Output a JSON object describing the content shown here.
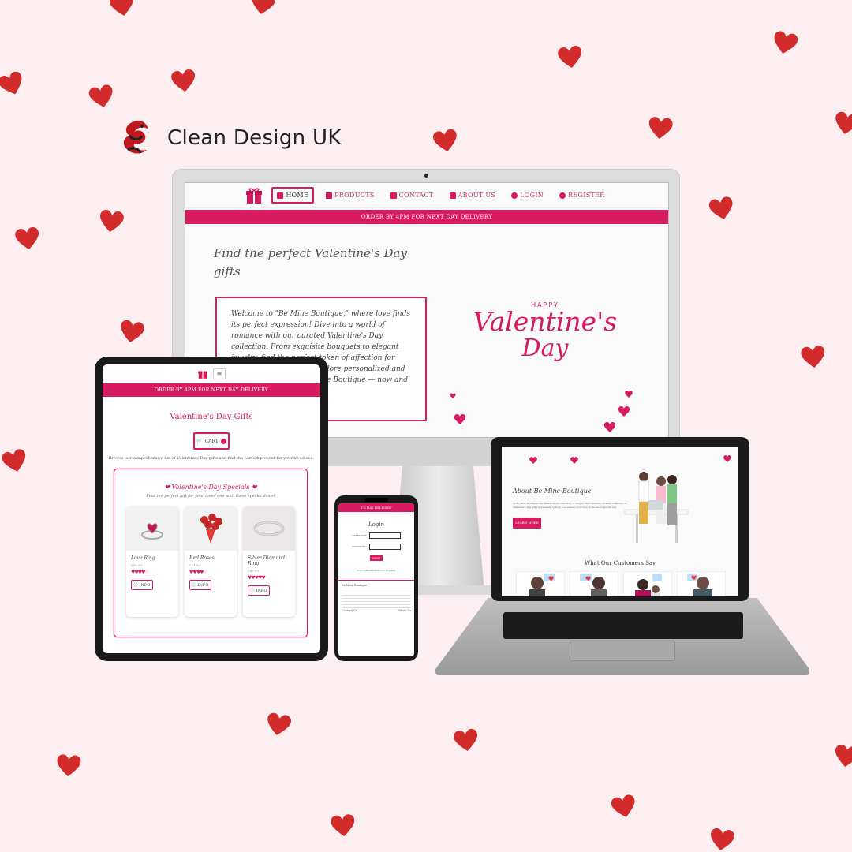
{
  "brand": {
    "name": "Clean Design UK"
  },
  "colors": {
    "accent": "#d81b60",
    "heart": "#d22b2b",
    "background": "#fdeef2"
  },
  "desktop": {
    "nav": [
      {
        "label": "HOME",
        "icon": "home-icon"
      },
      {
        "label": "PRODUCTS",
        "icon": "gift-icon"
      },
      {
        "label": "CONTACT",
        "icon": "envelope-icon"
      },
      {
        "label": "ABOUT US",
        "icon": "book-icon"
      },
      {
        "label": "LOGIN",
        "icon": "user-icon"
      },
      {
        "label": "REGISTER",
        "icon": "user-plus-icon"
      }
    ],
    "banner": "ORDER BY 4PM FOR NEXT DAY DELIVERY",
    "hero_title": "Find the perfect Valentine's Day gifts",
    "hero_text": "Welcome to \"Be Mine Boutique,\" where love finds its perfect expression! Dive into a world of romance with our curated Valentine's Day collection. From exquisite bouquets to elegant jewelry, find the perfect token of affection for your special someone. Explore personalized and delightful treats to Be Mine Boutique — now and let us be your moments.",
    "vday": {
      "happy": "HAPPY",
      "big": "Valentine's",
      "day": "Day"
    }
  },
  "tablet": {
    "banner": "ORDER BY 4PM FOR NEXT DAY DELIVERY",
    "title": "Valentine's Day Gifts",
    "cart_label": "CART",
    "cart_count": "0",
    "description": "Browse our comprehensive list of Valentine's Day gifts and find the perfect present for your loved one.",
    "specials_title": "Valentine's Day Specials",
    "specials_sub": "Find the perfect gift for your loved one with these special deals!",
    "products": [
      {
        "name": "Love Ring",
        "price": "£59.99",
        "hearts": "♥♥♥♥♡",
        "info": "INFO",
        "img": "ring-icon"
      },
      {
        "name": "Red Roses",
        "price": "£44.99",
        "hearts": "♥♥♥♥♡",
        "info": "INFO",
        "img": "roses-icon"
      },
      {
        "name": "Silver Diamond Ring",
        "price": "£49.99",
        "hearts": "♥♥♥♥♥",
        "info": "INFO",
        "img": "diamond-ring-icon"
      }
    ]
  },
  "phone": {
    "banner": "UK DAY DELIVERY",
    "login_title": "Login",
    "username_label": "USERNAME",
    "password_label": "PASSWORD",
    "login_button": "LOGIN",
    "register_text": "Don't have an account? Register",
    "footer_title": "Be Mine Boutique",
    "contact_title": "Contact Us",
    "follow_title": "Follow Us"
  },
  "laptop": {
    "about_title": "About Be Mine Boutique",
    "about_text": "At Be Mine Boutique, we believe every love story is unique. Our carefully curated collection of Valentine's Day gifts is designed to help you express your love in the most special way.",
    "learn_more": "LEARN MORE",
    "customers_title": "What Our Customers Say"
  }
}
